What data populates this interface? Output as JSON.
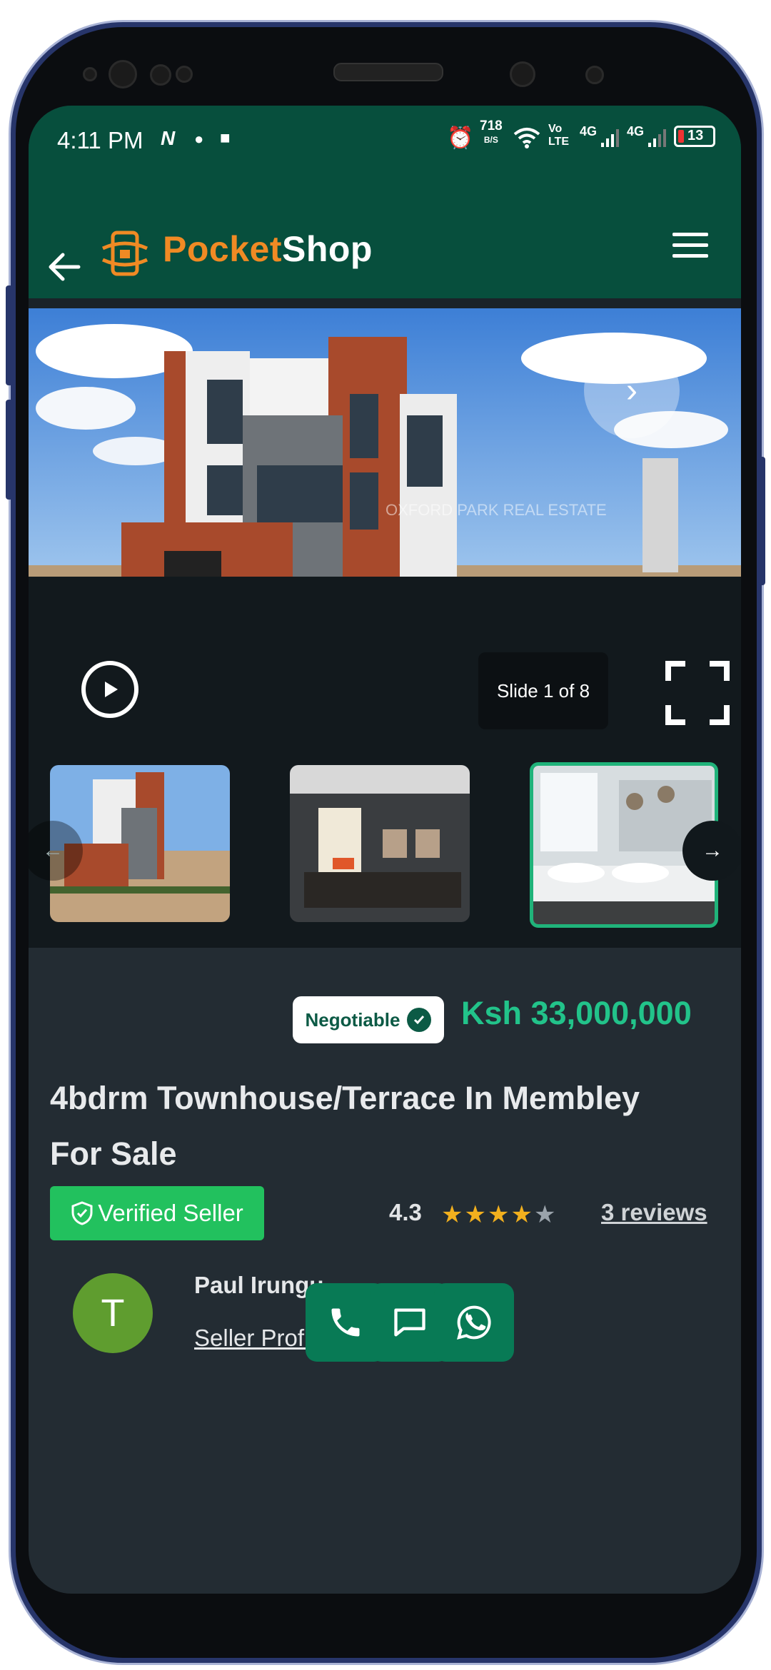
{
  "status_bar": {
    "time": "4:11 PM",
    "net_speed": "718",
    "net_unit": "B/S",
    "volte": "Vo LTE",
    "sim1": "4G",
    "sim2": "4G",
    "battery": "13"
  },
  "app_bar": {
    "brand_part1": "Pocket",
    "brand_part2": "Shop"
  },
  "gallery": {
    "slide_counter": "Slide 1 of 8",
    "current_slide": 1,
    "total_slides": 8,
    "hero_watermark": "OXFORD PARK REAL ESTATE"
  },
  "listing": {
    "negotiable_label": "Negotiable",
    "price": "Ksh 33,000,000",
    "title": "4bdrm Townhouse/Terrace In Membley For Sale",
    "verified_label": "Verified Seller",
    "rating": "4.3",
    "stars_filled": 4,
    "stars_total": 5,
    "reviews_link": "3 reviews"
  },
  "seller": {
    "avatar_initial": "T",
    "name": "Paul Irungu",
    "profile_link": "Seller Profile"
  },
  "colors": {
    "brand_green": "#074f3d",
    "brand_orange": "#f08a24",
    "price_green": "#22c38a",
    "verified_green": "#22c15e",
    "action_green": "#087a55",
    "star_gold": "#f2b01e"
  }
}
